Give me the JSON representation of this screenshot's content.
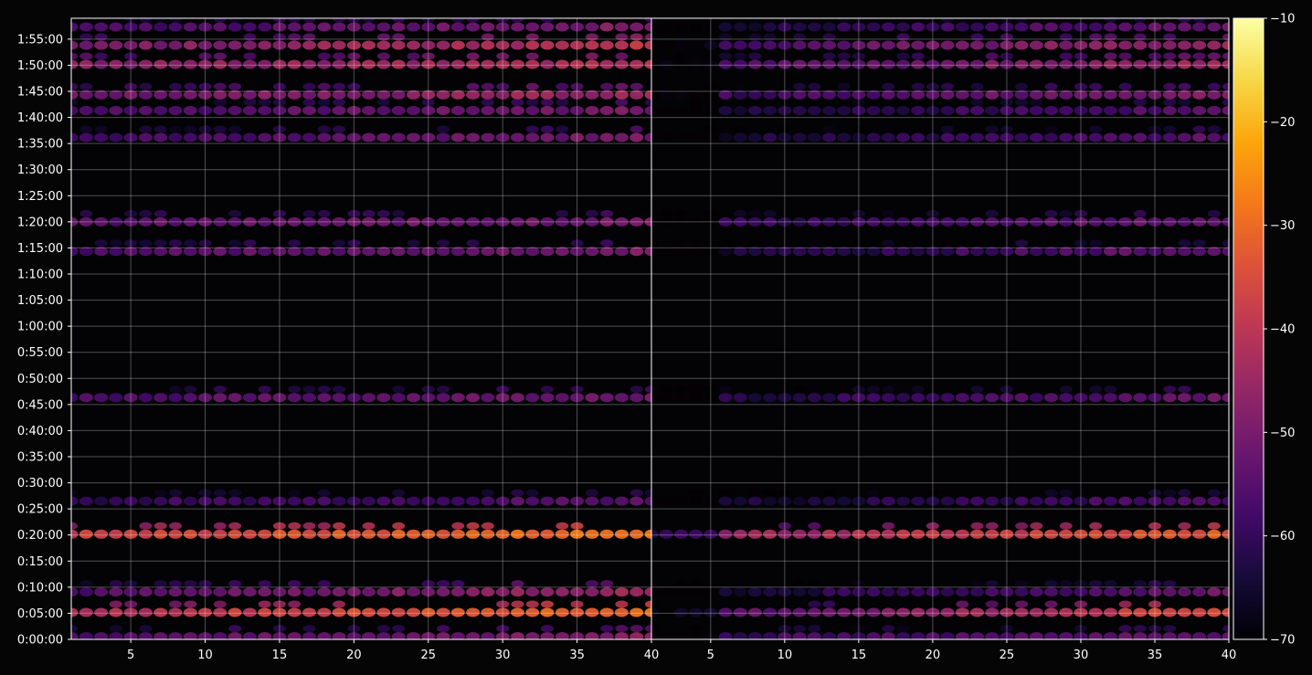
{
  "chart_data": {
    "type": "heatmap",
    "panels": 2,
    "colormap": "inferno",
    "grid": true,
    "x_ticks": [
      5,
      10,
      15,
      20,
      25,
      30,
      35,
      40
    ],
    "x_range": [
      1,
      40
    ],
    "y_range_seconds": [
      0,
      7140
    ],
    "y_tick_labels": [
      "0:00:00",
      "0:05:00",
      "0:10:00",
      "0:15:00",
      "0:20:00",
      "0:25:00",
      "0:30:00",
      "0:35:00",
      "0:40:00",
      "0:45:00",
      "0:50:00",
      "0:55:00",
      "1:00:00",
      "1:05:00",
      "1:10:00",
      "1:15:00",
      "1:20:00",
      "1:25:00",
      "1:30:00",
      "1:35:00",
      "1:40:00",
      "1:45:00",
      "1:50:00",
      "1:55:00"
    ],
    "colorbar": {
      "min": -70,
      "max": -10,
      "tick_labels": [
        "−10",
        "−20",
        "−30",
        "−40",
        "−50",
        "−60",
        "−70"
      ],
      "tick_values": [
        -10,
        -20,
        -30,
        -40,
        -50,
        -60,
        -70
      ]
    },
    "bands": [
      {
        "time_s": 30,
        "left": [
          -55,
          -48
        ],
        "right": [
          -60,
          -52
        ]
      },
      {
        "time_s": 310,
        "left": [
          -42,
          -28
        ],
        "right": [
          -58,
          -34
        ]
      },
      {
        "time_s": 545,
        "left": [
          -56,
          -44
        ],
        "right": [
          -66,
          -52
        ]
      },
      {
        "time_s": 1210,
        "left": [
          -38,
          -28
        ],
        "right": [
          -48,
          -32
        ]
      },
      {
        "time_s": 1590,
        "left": [
          -60,
          -54
        ],
        "right": [
          -66,
          -56
        ]
      },
      {
        "time_s": 2780,
        "left": [
          -56,
          -50
        ],
        "right": [
          -64,
          -52
        ]
      },
      {
        "time_s": 4800,
        "left": [
          -55,
          -50
        ],
        "right": [
          -62,
          -52
        ]
      },
      {
        "time_s": 4460,
        "left": [
          -56,
          -50
        ],
        "right": [
          -66,
          -52
        ]
      },
      {
        "time_s": 5770,
        "left": [
          -58,
          -50
        ],
        "right": [
          -66,
          -54
        ]
      },
      {
        "time_s": 6080,
        "left": [
          -56,
          -50
        ],
        "right": [
          -66,
          -54
        ]
      },
      {
        "time_s": 6260,
        "left": [
          -52,
          -44
        ],
        "right": [
          -60,
          -48
        ]
      },
      {
        "time_s": 6610,
        "left": [
          -48,
          -42
        ],
        "right": [
          -58,
          -44
        ]
      },
      {
        "time_s": 6830,
        "left": [
          -50,
          -40
        ],
        "right": [
          -58,
          -44
        ]
      },
      {
        "time_s": 7040,
        "left": [
          -58,
          -48
        ],
        "right": [
          -66,
          -52
        ]
      }
    ]
  }
}
